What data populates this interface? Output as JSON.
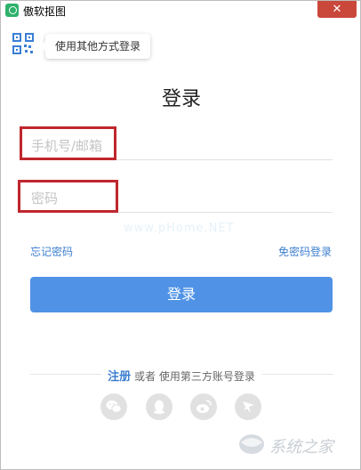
{
  "window": {
    "title": "傲软抠图",
    "close_glyph": "✕"
  },
  "qr_login": {
    "icon": "qr-code-icon",
    "tooltip": "使用其他方式登录"
  },
  "form": {
    "heading": "登录",
    "phone": {
      "placeholder": "手机号/邮箱",
      "value": ""
    },
    "password": {
      "placeholder": "密码",
      "value": ""
    },
    "watermark_text": "www.pHome.NET",
    "forgot_password": "忘记密码",
    "password_free_login": "免密码登录",
    "submit_label": "登录"
  },
  "third_party": {
    "register": "注册",
    "or": "或者",
    "text": "使用第三方账号登录",
    "buttons": [
      {
        "icon": "wechat-icon"
      },
      {
        "icon": "qq-icon"
      },
      {
        "icon": "weibo-icon"
      },
      {
        "icon": "dingtalk-icon"
      }
    ]
  },
  "site_watermark": {
    "text": "系统之家"
  },
  "colors": {
    "accent": "#5093e6",
    "link": "#3d7fcf",
    "highlight": "#c0262d",
    "close": "#c9483b"
  }
}
